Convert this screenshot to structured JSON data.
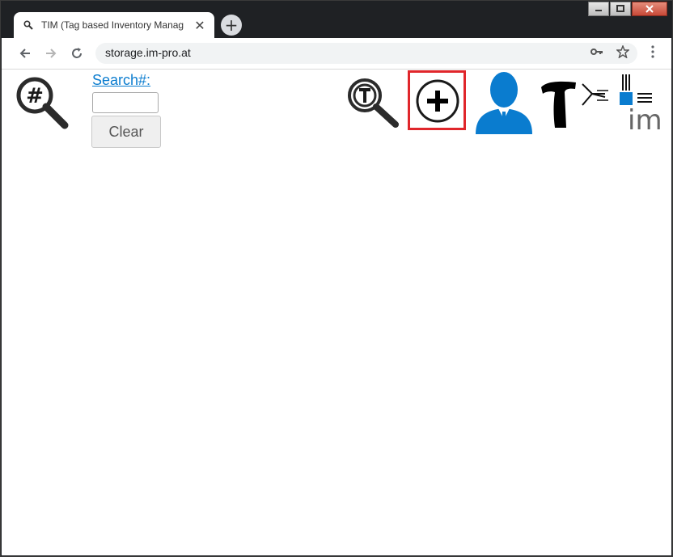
{
  "browser": {
    "tab_title": "TIM (Tag based Inventory Manag",
    "url": "storage.im-pro.at",
    "new_tab": "+",
    "tab_close": "✕"
  },
  "page": {
    "search_label": "Search#:",
    "search_value": "",
    "clear_label": "Clear",
    "brand_text": "im"
  },
  "colors": {
    "link": "#0a7ccf",
    "user_icon": "#0a7ccf",
    "highlight": "#e0262b",
    "brand_square": "#0a7ccf"
  }
}
